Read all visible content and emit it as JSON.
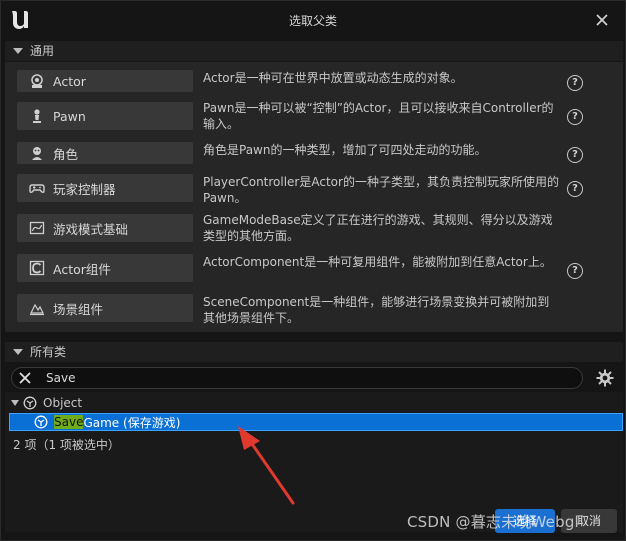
{
  "window": {
    "title": "选取父类"
  },
  "common": {
    "header": "通用",
    "items": [
      {
        "label": "Actor",
        "icon": "actor-icon",
        "description": "Actor是一种可在世界中放置或动态生成的对象。"
      },
      {
        "label": "Pawn",
        "icon": "pawn-icon",
        "description": "Pawn是一种可以被“控制”的Actor，且可以接收来自Controller的输入。"
      },
      {
        "label": "角色",
        "icon": "character-icon",
        "description": "角色是Pawn的一种类型，增加了可四处走动的功能。"
      },
      {
        "label": "玩家控制器",
        "icon": "gamepad-icon",
        "description": "PlayerController是Actor的一种子类型，其负责控制玩家所使用的Pawn。"
      },
      {
        "label": "游戏模式基础",
        "icon": "game-mode-icon",
        "description": "GameModeBase定义了正在进行的游戏、其规则、得分以及游戏类型的其他方面。"
      },
      {
        "label": "Actor组件",
        "icon": "actor-component-icon",
        "description": "ActorComponent是一种可复用组件，能被附加到任意Actor上。"
      },
      {
        "label": "场景组件",
        "icon": "scene-component-icon",
        "description": "SceneComponent是一种组件，能够进行场景变换并可被附加到其他场景组件下。"
      }
    ],
    "help_glyph": "?"
  },
  "all_classes": {
    "header": "所有类",
    "search_value": "Save",
    "tree": {
      "parent": "Object",
      "selected_highlight": "Save",
      "selected_rest": "Game (保存游戏)"
    },
    "count_text": "2 项（1 项被选中）"
  },
  "buttons": {
    "select": "选择",
    "cancel": "取消"
  },
  "watermark": "CSDN @暮志未晚Webgl",
  "colors": {
    "accent": "#0a70d6",
    "highlight": "#6fae1a",
    "arrow": "#e03a2f"
  }
}
